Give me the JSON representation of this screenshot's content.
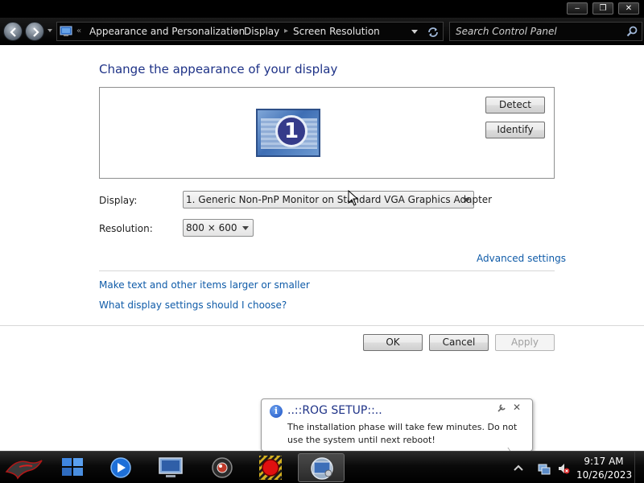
{
  "window": {
    "min_glyph": "‒",
    "max_glyph": "❐",
    "close_glyph": "✕"
  },
  "address_bar": {
    "crumbs": [
      "Appearance and Personalization",
      "Display",
      "Screen Resolution"
    ],
    "separator": "▸",
    "leading_separator": "«",
    "search_placeholder": "Search Control Panel"
  },
  "main": {
    "heading": "Change the appearance of your display",
    "monitor_number": "1",
    "detect_label": "Detect",
    "identify_label": "Identify",
    "display_label": "Display:",
    "display_value": "1. Generic Non-PnP Monitor on Standard VGA Graphics Adapter",
    "resolution_label": "Resolution:",
    "resolution_value": "800 × 600",
    "advanced_link": "Advanced settings",
    "link_text_size": "Make text and other items larger or smaller",
    "link_help": "What display settings should I choose?",
    "ok_label": "OK",
    "cancel_label": "Cancel",
    "apply_label": "Apply"
  },
  "notification": {
    "title": "..::ROG SETUP::..",
    "body": "The installation phase will take few minutes. Do not use the system until next reboot!",
    "close_glyph": "✕",
    "info_glyph": "i"
  },
  "taskbar": {
    "time": "9:17 AM",
    "date": "10/26/2023",
    "items": [
      "rog-start",
      "explorer",
      "media-player",
      "remote-desktop",
      "camera-app",
      "record-app",
      "display-settings"
    ]
  },
  "colors": {
    "heading": "#1e3287",
    "link": "#0f5ba8",
    "taskbar": "#000000"
  }
}
